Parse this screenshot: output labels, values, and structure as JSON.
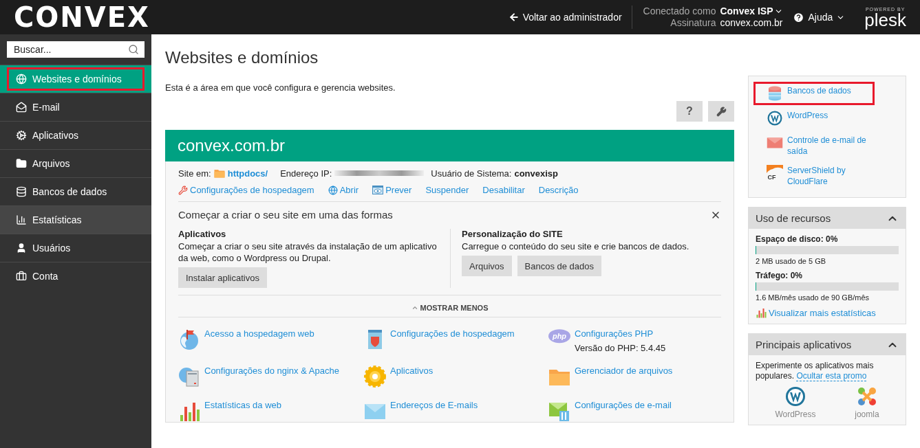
{
  "header": {
    "logo": "CONVEX",
    "back_link": "Voltar ao administrador",
    "connected_label": "Conectado como",
    "account": "Convex ISP",
    "subscription_label": "Assinatura",
    "subscription": "convex.com.br",
    "help": "Ajuda",
    "powered_by": "POWERED BY",
    "brand": "plesk"
  },
  "sidebar": {
    "search_placeholder": "Buscar...",
    "items": [
      {
        "label": "Websites e domínios",
        "kind": "globe",
        "selected": true,
        "highlighted": true
      },
      {
        "label": "E-mail",
        "kind": "mail",
        "selected": false,
        "highlighted": false
      },
      {
        "label": "Aplicativos",
        "kind": "gear",
        "selected": false,
        "highlighted": false
      },
      {
        "label": "Arquivos",
        "kind": "folder",
        "selected": false,
        "highlighted": false
      },
      {
        "label": "Bancos de dados",
        "kind": "database",
        "selected": false,
        "highlighted": false
      },
      {
        "label": "Estatísticas",
        "kind": "chart",
        "selected": false,
        "hovered": true,
        "highlighted": false
      },
      {
        "label": "Usuários",
        "kind": "user",
        "selected": false,
        "highlighted": false
      },
      {
        "label": "Conta",
        "kind": "briefcase",
        "selected": false,
        "highlighted": false
      }
    ]
  },
  "page": {
    "title": "Websites e domínios",
    "description": "Esta é a área em que você configura e gerencia websites.",
    "help_button": "?"
  },
  "domain": {
    "name": "convex.com.br",
    "site_label": "Site em:",
    "docroot": "httpdocs/",
    "ip_label": "Endereço IP:",
    "user_label": "Usuário de Sistema:",
    "user": "convexisp",
    "actions": [
      {
        "label": "Configurações de hospedagem",
        "kind": "tools"
      },
      {
        "label": "Abrir",
        "kind": "open"
      },
      {
        "label": "Prever",
        "kind": "preview"
      },
      {
        "label": "Suspender",
        "kind": "plain"
      },
      {
        "label": "Desabilitar",
        "kind": "plain"
      },
      {
        "label": "Descrição",
        "kind": "plain"
      }
    ],
    "start": {
      "title": "Começar a criar o seu site em uma das formas",
      "columns": [
        {
          "title": "Aplicativos",
          "text": "Começar a criar o seu site através da instalação de um aplicativo da web, como o Wordpress ou Drupal.",
          "buttons": [
            "Instalar aplicativos"
          ]
        },
        {
          "title": "Personalização do SITE",
          "text": "Carregue o conteúdo do seu site e crie bancos de dados.",
          "buttons": [
            "Arquivos",
            "Bancos de dados"
          ]
        }
      ]
    },
    "toggle": "MOSTRAR MENOS",
    "tools": [
      {
        "label": "Acesso a hospedagem web",
        "kind": "globe-flag"
      },
      {
        "label": "Configurações de hospedagem",
        "kind": "shield"
      },
      {
        "label": "Configurações PHP",
        "kind": "php",
        "php_label": "php",
        "note": "Versão do PHP: 5.4.45"
      },
      {
        "label": "Configurações do nginx & Apache",
        "kind": "server"
      },
      {
        "label": "Aplicativos",
        "kind": "sun-gear"
      },
      {
        "label": "Gerenciador de arquivos",
        "kind": "folder"
      },
      {
        "label": "Estatísticas da web",
        "kind": "bars"
      },
      {
        "label": "Endereços de E-mails",
        "kind": "envelope"
      },
      {
        "label": "Configurações de e-mail",
        "kind": "mail-settings"
      }
    ]
  },
  "right": {
    "quick_links": [
      {
        "label": "Bancos de dados",
        "kind": "database",
        "highlighted": true
      },
      {
        "label": "WordPress",
        "kind": "wordpress",
        "highlighted": false
      },
      {
        "label": "Controle de e-mail de saída",
        "kind": "envelope-red",
        "highlighted": false
      },
      {
        "label": "ServerShield by CloudFlare",
        "kind": "cloudflare",
        "cf_label": "CF",
        "highlighted": false
      }
    ],
    "resources": {
      "title": "Uso de recursos",
      "expanded": true,
      "meters": [
        {
          "label": "Espaço de disco: 0%",
          "level": 0,
          "reading": "2 MB usado de 5 GB"
        },
        {
          "label": "Tráfego: 0%",
          "level": 0,
          "reading": "1.6 MB/mês usado de 90 GB/mês"
        }
      ],
      "stats_link": "Visualizar mais estatísticas"
    },
    "apps": {
      "title": "Principais aplicativos",
      "expanded": true,
      "text": "Experimente os aplicativos mais populares.",
      "hide_link": "Ocultar esta promo",
      "apps": [
        {
          "label": "WordPress",
          "kind": "wordpress"
        },
        {
          "label": "joomla",
          "kind": "joomla"
        }
      ]
    }
  }
}
